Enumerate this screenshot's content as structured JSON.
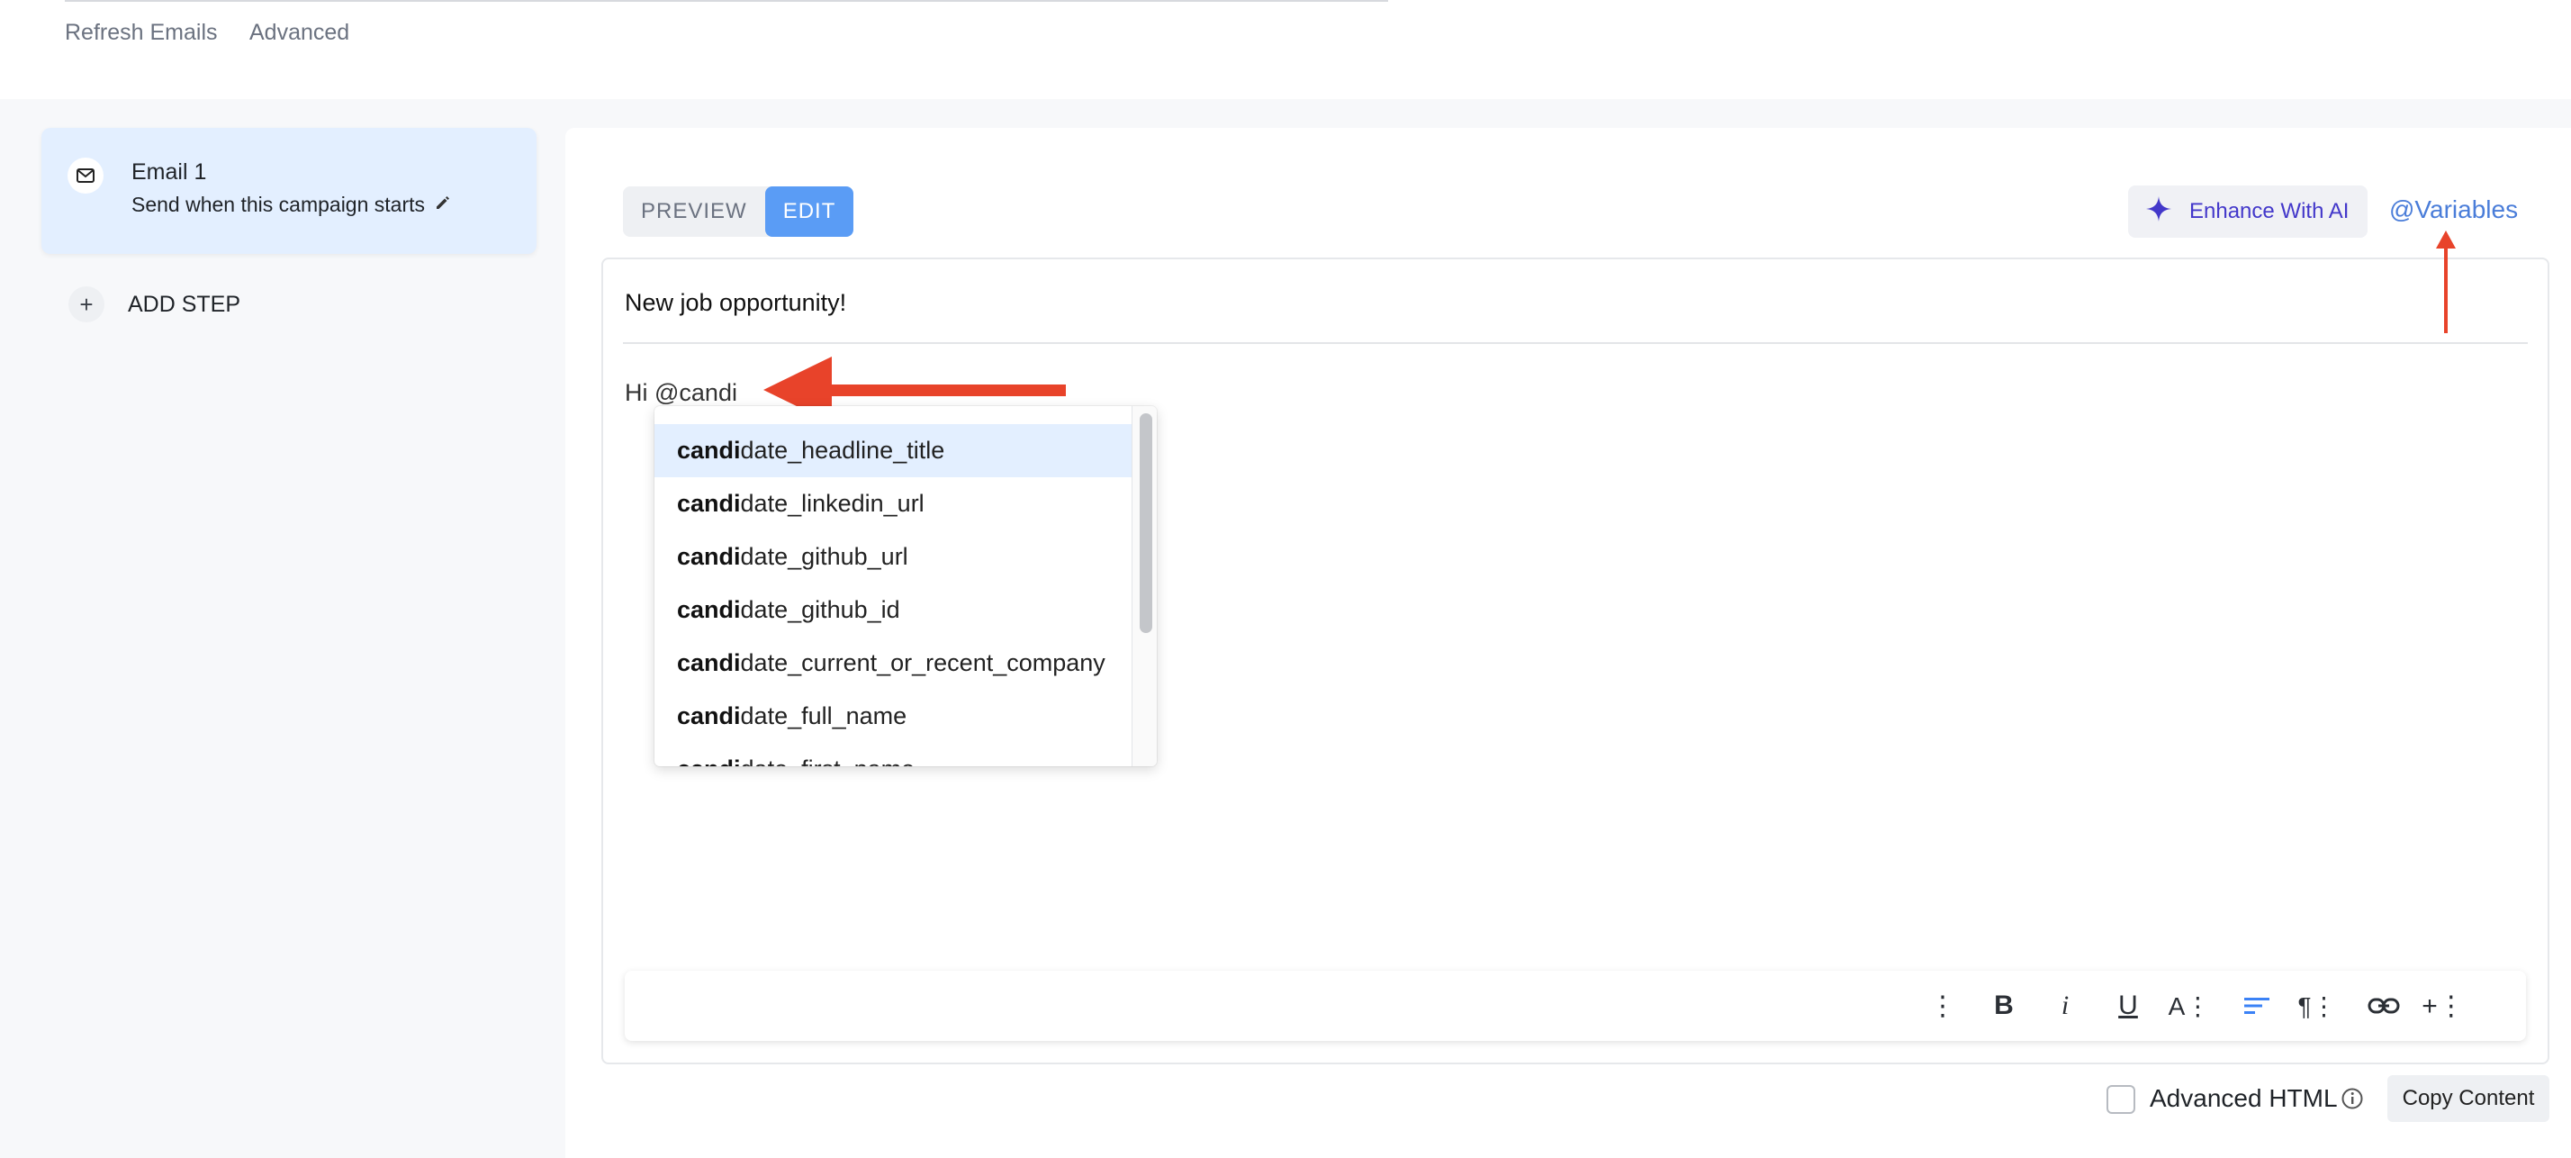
{
  "topbar": {
    "refresh_label": "Refresh Emails",
    "advanced_label": "Advanced"
  },
  "sidebar": {
    "step": {
      "title": "Email 1",
      "subtitle": "Send when this campaign starts"
    },
    "add_step_label": "ADD STEP"
  },
  "editor": {
    "tabs": [
      {
        "label": "PREVIEW",
        "active": false
      },
      {
        "label": "EDIT",
        "active": true
      }
    ],
    "enhance_label": "Enhance With AI",
    "variables_label": "@Variables",
    "subject": "New job opportunity!",
    "body": "Hi @candi",
    "suggestions": {
      "typed_prefix": "candi",
      "items": [
        "date_headline_title",
        "date_linkedin_url",
        "date_github_url",
        "date_github_id",
        "date_current_or_recent_company",
        "date_full_name",
        "date_first_name"
      ]
    },
    "toolbar": {
      "more": "⋮",
      "bold": "B",
      "italic": "i",
      "underline": "U",
      "font": "A⋮",
      "paragraph": "¶⋮",
      "insert": "+⋮"
    }
  },
  "footer": {
    "advanced_html_label": "Advanced HTML",
    "copy_label": "Copy Content"
  },
  "colors": {
    "accent": "#5a9cf5",
    "annotation": "#e8432a",
    "ai": "#4338ca"
  }
}
